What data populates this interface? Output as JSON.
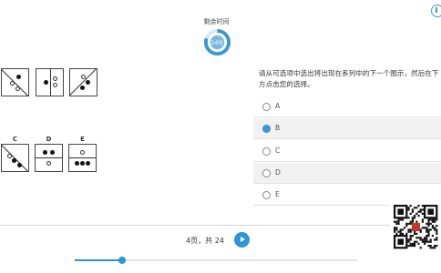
{
  "timer": {
    "label": "剩余时间",
    "value": "24分",
    "progress": 0.8
  },
  "question": {
    "text": "请从可选项中选出将出现在系列中的下一个图示，然后在下方点击您的选择。"
  },
  "answer_figures": {
    "labels": [
      "C",
      "D",
      "E"
    ]
  },
  "options": [
    {
      "letter": "A",
      "selected": false
    },
    {
      "letter": "B",
      "selected": true
    },
    {
      "letter": "C",
      "selected": false
    },
    {
      "letter": "D",
      "selected": false
    },
    {
      "letter": "E",
      "selected": false
    }
  ],
  "footer": {
    "page_text": "4页，共 24",
    "slider_fraction": 0.17
  },
  "colors": {
    "accent": "#2d95d6",
    "option_alt_bg": "#f1f1f1"
  },
  "icons": {
    "next": "play-icon",
    "corner": "info-icon"
  }
}
